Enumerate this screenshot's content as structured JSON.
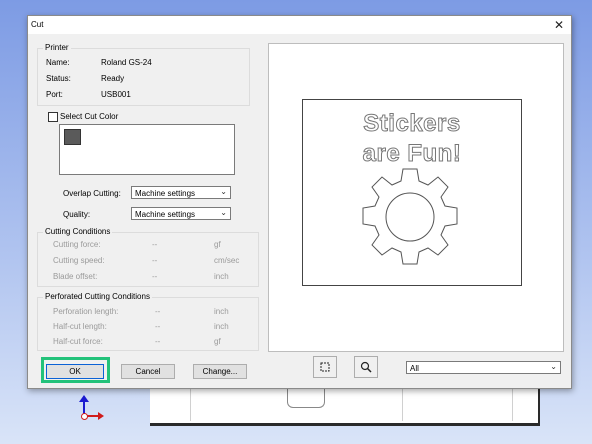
{
  "dialog": {
    "title": "Cut"
  },
  "printer": {
    "group_title": "Printer",
    "name_label": "Name:",
    "name_value": "Roland GS-24",
    "status_label": "Status:",
    "status_value": "Ready",
    "port_label": "Port:",
    "port_value": "USB001"
  },
  "cut_color": {
    "label": "Select Cut Color",
    "checked": false,
    "swatch_color": "#5a5a5a"
  },
  "overlap": {
    "label": "Overlap Cutting:",
    "value": "Machine settings"
  },
  "quality": {
    "label": "Quality:",
    "value": "Machine settings"
  },
  "cutting_conditions": {
    "title": "Cutting Conditions",
    "rows": [
      {
        "label": "Cutting force:",
        "value": "--",
        "unit": "gf"
      },
      {
        "label": "Cutting speed:",
        "value": "--",
        "unit": "cm/sec"
      },
      {
        "label": "Blade offset:",
        "value": "--",
        "unit": "inch"
      }
    ]
  },
  "perforated": {
    "title": "Perforated Cutting Conditions",
    "rows": [
      {
        "label": "Perforation length:",
        "value": "--",
        "unit": "inch"
      },
      {
        "label": "Half-cut length:",
        "value": "--",
        "unit": "inch"
      },
      {
        "label": "Half-cut force:",
        "value": "--",
        "unit": "gf"
      }
    ]
  },
  "buttons": {
    "ok": "OK",
    "cancel": "Cancel",
    "change": "Change..."
  },
  "preview": {
    "line1": "Stickers",
    "line2": "are Fun!",
    "page_select": "All"
  },
  "colors": {
    "highlight": "#23c27a",
    "axis_y": "#1b1bd0",
    "axis_x": "#d01b1b"
  }
}
